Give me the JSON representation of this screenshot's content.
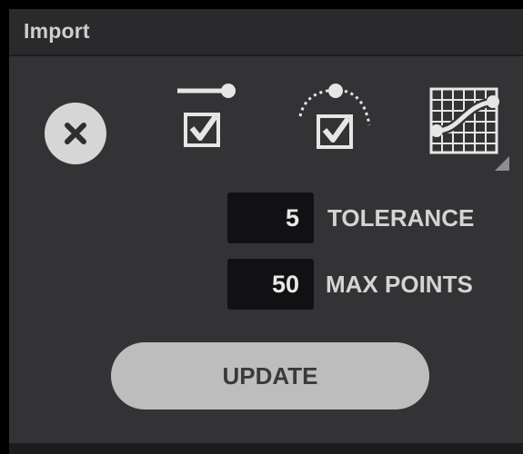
{
  "panel": {
    "title": "Import"
  },
  "toolbar": {
    "tools": [
      {
        "name": "cancel",
        "icon": "close-icon"
      },
      {
        "name": "endpoint-check",
        "icon": "line-endpoint-checkbox-icon"
      },
      {
        "name": "arc-check",
        "icon": "arc-checkbox-icon"
      },
      {
        "name": "curve-grid",
        "icon": "curve-grid-icon"
      }
    ]
  },
  "fields": {
    "tolerance": {
      "value": "5",
      "label": "TOLERANCE"
    },
    "max_points": {
      "value": "50",
      "label": "MAX POINTS"
    }
  },
  "actions": {
    "update_label": "UPDATE"
  },
  "colors": {
    "panel_bg": "#333335",
    "header_bg": "#2a2a2c",
    "field_bg": "#111113",
    "button_bg": "#bdbdbd",
    "icon_light": "#e6e6e6"
  }
}
